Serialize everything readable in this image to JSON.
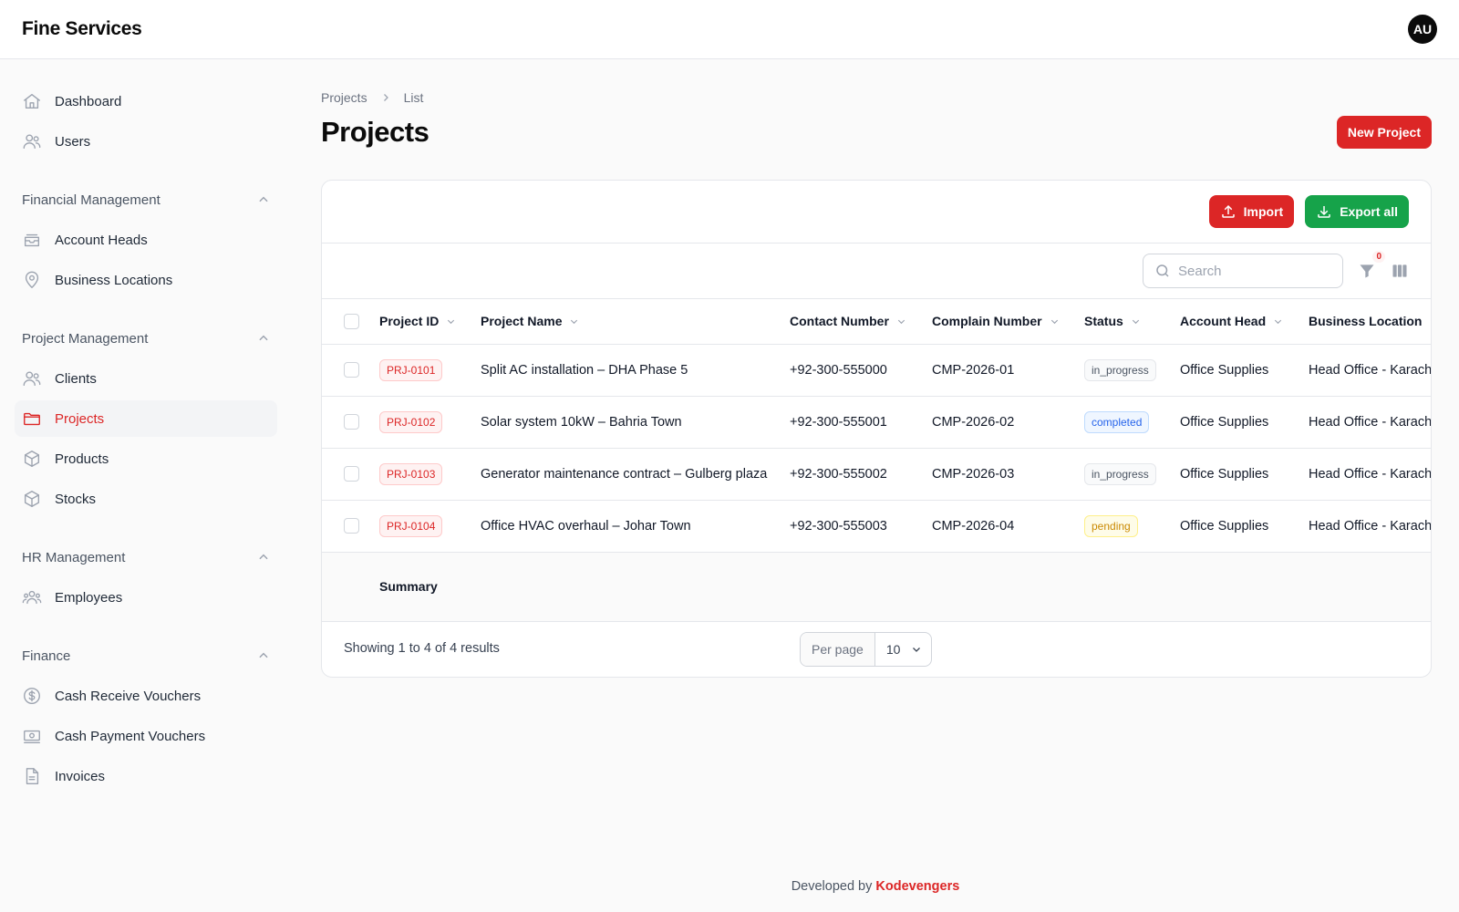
{
  "app": {
    "brand": "Fine Services",
    "user_initials": "AU"
  },
  "sidebar": {
    "top_items": [
      {
        "label": "Dashboard",
        "icon": "home-icon"
      },
      {
        "label": "Users",
        "icon": "users-icon"
      }
    ],
    "groups": [
      {
        "label": "Financial Management",
        "items": [
          {
            "label": "Account Heads",
            "icon": "inbox-stack-icon"
          },
          {
            "label": "Business Locations",
            "icon": "map-pin-icon"
          }
        ]
      },
      {
        "label": "Project Management",
        "items": [
          {
            "label": "Clients",
            "icon": "users-icon"
          },
          {
            "label": "Projects",
            "icon": "folder-icon",
            "active": true
          },
          {
            "label": "Products",
            "icon": "cube-icon"
          },
          {
            "label": "Stocks",
            "icon": "cube-icon"
          }
        ]
      },
      {
        "label": "HR Management",
        "items": [
          {
            "label": "Employees",
            "icon": "user-group-icon"
          }
        ]
      },
      {
        "label": "Finance",
        "items": [
          {
            "label": "Cash Receive Vouchers",
            "icon": "dollar-circle-icon"
          },
          {
            "label": "Cash Payment Vouchers",
            "icon": "banknotes-icon"
          },
          {
            "label": "Invoices",
            "icon": "document-icon"
          }
        ]
      }
    ]
  },
  "breadcrumb": {
    "root": "Projects",
    "current": "List"
  },
  "page": {
    "title": "Projects",
    "new_button": "New Project"
  },
  "actions": {
    "import": "Import",
    "export": "Export all"
  },
  "toolbar": {
    "search_placeholder": "Search",
    "filter_count": "0"
  },
  "table": {
    "columns": [
      "Project ID",
      "Project Name",
      "Contact Number",
      "Complain Number",
      "Status",
      "Account Head",
      "Business Location"
    ],
    "rows": [
      {
        "id": "PRJ-0101",
        "name": "Split AC installation – DHA Phase 5",
        "contact": "+92-300-555000",
        "complain": "CMP-2026-01",
        "status": "in_progress",
        "account": "Office Supplies",
        "location": "Head Office - Karachi"
      },
      {
        "id": "PRJ-0102",
        "name": "Solar system 10kW – Bahria Town",
        "contact": "+92-300-555001",
        "complain": "CMP-2026-02",
        "status": "completed",
        "account": "Office Supplies",
        "location": "Head Office - Karachi"
      },
      {
        "id": "PRJ-0103",
        "name": "Generator maintenance contract – Gulberg plaza",
        "contact": "+92-300-555002",
        "complain": "CMP-2026-03",
        "status": "in_progress",
        "account": "Office Supplies",
        "location": "Head Office - Karachi"
      },
      {
        "id": "PRJ-0104",
        "name": "Office HVAC overhaul – Johar Town",
        "contact": "+92-300-555003",
        "complain": "CMP-2026-04",
        "status": "pending",
        "account": "Office Supplies",
        "location": "Head Office - Karachi"
      }
    ],
    "summary_label": "Summary"
  },
  "pagination": {
    "showing": "Showing 1 to 4 of 4 results",
    "per_page_label": "Per page",
    "per_page_value": "10"
  },
  "footer": {
    "prefix": "Developed by ",
    "company": "Kodevengers"
  },
  "colors": {
    "accent": "#dc2626",
    "export": "#16a34a"
  }
}
